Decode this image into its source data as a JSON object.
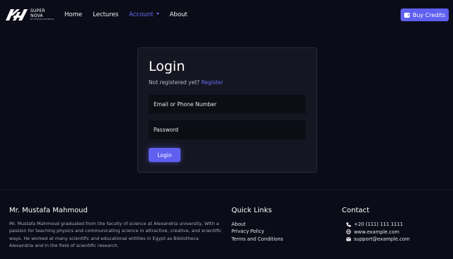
{
  "brand": {
    "line1": "SUPER",
    "line2": "NOVA",
    "tagline": "BY MUSTAFA MAHMOUD",
    "logo_icon": "supernova-logo-icon"
  },
  "nav": {
    "items": [
      {
        "label": "Home"
      },
      {
        "label": "Lectures"
      },
      {
        "label": "Account"
      },
      {
        "label": "About"
      }
    ],
    "active": "Account",
    "buy_credits": "Buy Credits",
    "buy_icon": "wallet-icon"
  },
  "login": {
    "title": "Login",
    "not_registered": "Not registered yet?",
    "register_link": "Register",
    "email_placeholder": "Email or Phone Number",
    "password_placeholder": "Password",
    "submit": "Login"
  },
  "footer": {
    "about_title": "Mr. Mustafa Mahmoud",
    "about_text": "Mr. Mustafa Mahmoud graduated from the faculty of science at Alexandria university, With a passion for teaching physics and communicating science in attractive, creative, and scientific ways. He worked at many scientific and educational entities in Egypt as Bibliotheca Alexandria and in the field of scientific research.",
    "links_title": "Quick Links",
    "links": [
      "About",
      "Privacy Policy",
      "Terms and Conditions"
    ],
    "contact_title": "Contact",
    "contacts": [
      {
        "icon": "phone-icon",
        "text": "+20 (111) 111 1111"
      },
      {
        "icon": "globe-icon",
        "text": "www.example.com"
      },
      {
        "icon": "envelope-icon",
        "text": "support@example.com"
      }
    ]
  },
  "colors": {
    "background": "#0c0c18",
    "card": "#161622",
    "accent": "#5f60f0",
    "link": "#6b6cf5"
  }
}
